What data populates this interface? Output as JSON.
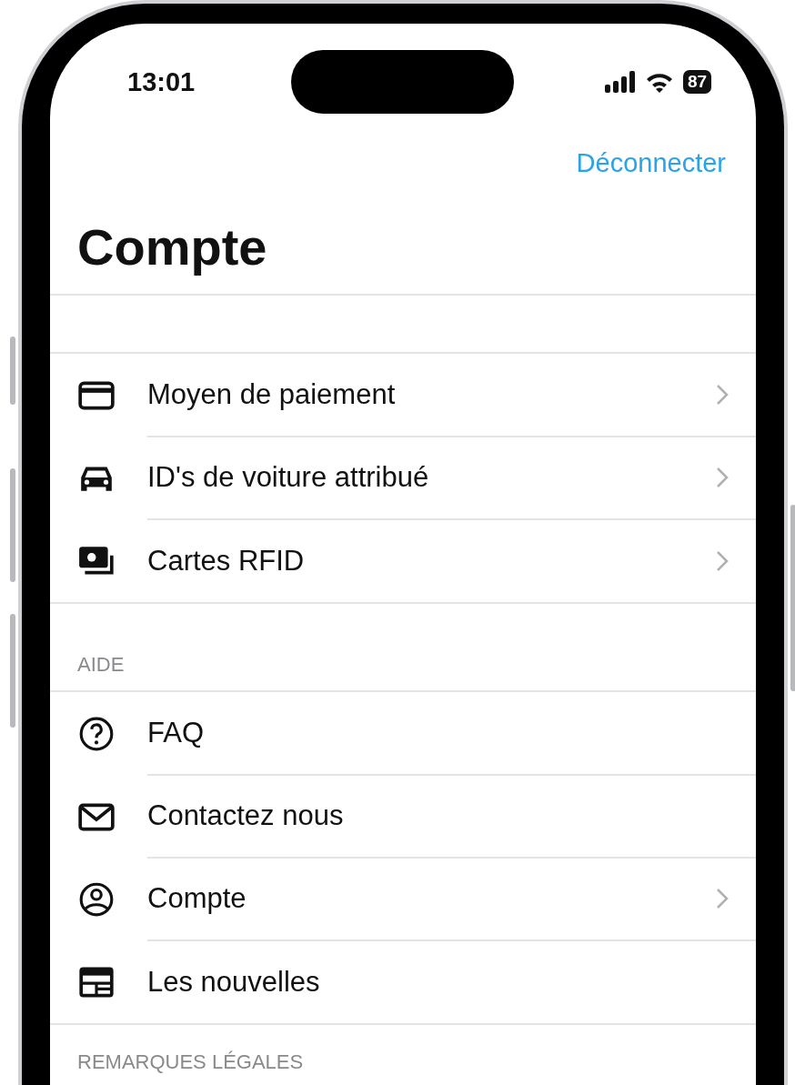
{
  "status_bar": {
    "time": "13:01",
    "battery": "87"
  },
  "nav": {
    "action": "Déconnecter",
    "title": "Compte"
  },
  "sections": [
    {
      "items": [
        {
          "kind": "card",
          "label": "Moyen de paiement",
          "chevron": true
        },
        {
          "kind": "car",
          "label": "ID's de voiture attribué",
          "chevron": true
        },
        {
          "kind": "rfid",
          "label": "Cartes RFID",
          "chevron": true
        }
      ]
    },
    {
      "header": "AIDE",
      "items": [
        {
          "kind": "help",
          "label": "FAQ",
          "chevron": false
        },
        {
          "kind": "mail",
          "label": "Contactez nous",
          "chevron": false
        },
        {
          "kind": "user",
          "label": "Compte",
          "chevron": true
        },
        {
          "kind": "news",
          "label": "Les nouvelles",
          "chevron": false
        }
      ]
    },
    {
      "header": "REMARQUES LÉGALES"
    }
  ]
}
